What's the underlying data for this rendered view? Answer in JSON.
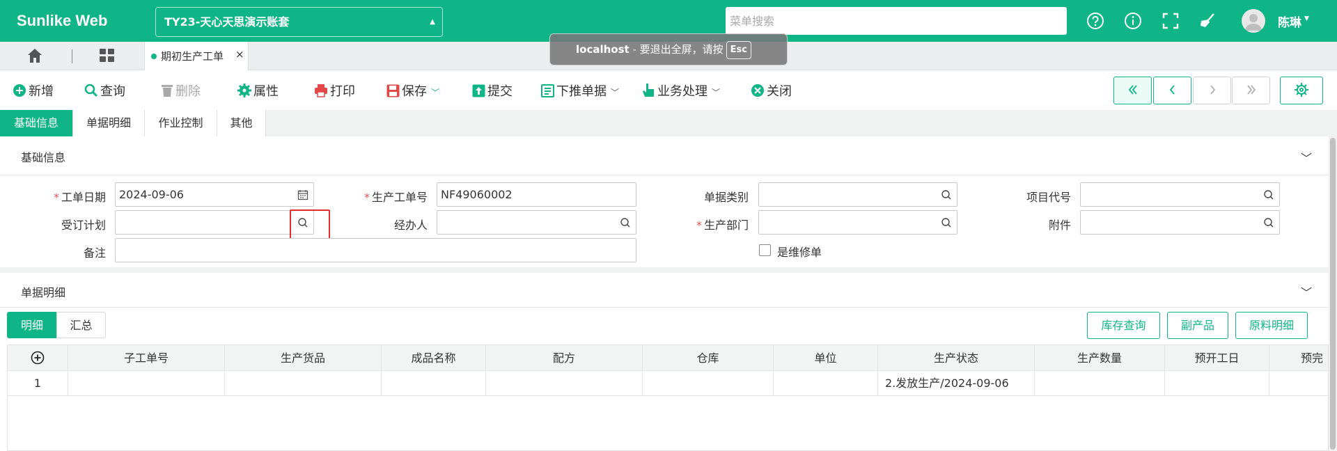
{
  "app": {
    "brand": "Sunlike Web",
    "account": "TY23-天心天思演示账套",
    "menu_search_placeholder": "菜单搜索",
    "user_name": "陈琳",
    "accent_color": "#0fb587",
    "top_icons": [
      "help-icon",
      "info-icon",
      "fullscreen-icon",
      "broom-icon"
    ]
  },
  "tabs": {
    "open_tab": "期初生产工单",
    "close_glyph": "×"
  },
  "toast": {
    "host": "localhost",
    "separator": " - ",
    "message": "要退出全屏，请按",
    "key": "Esc"
  },
  "toolbar": {
    "new": "新增",
    "query": "查询",
    "delete": "删除",
    "properties": "属性",
    "print": "打印",
    "save": "保存",
    "submit": "提交",
    "push_down": "下推单据",
    "business": "业务处理",
    "close": "关闭"
  },
  "section_tabs": [
    "基础信息",
    "单据明细",
    "作业控制",
    "其他"
  ],
  "basic": {
    "title": "基础信息",
    "fields": {
      "work_date_label": "工单日期",
      "work_date_value": "2024-09-06",
      "work_no_label": "生产工单号",
      "work_no_value": "NF49060002",
      "doc_type_label": "单据类别",
      "project_code_label": "项目代号",
      "order_plan_label": "受订计划",
      "handler_label": "经办人",
      "dept_label": "生产部门",
      "attachment_label": "附件",
      "remark_label": "备注",
      "repair_label": "是维修单"
    }
  },
  "detail": {
    "title": "单据明细",
    "subtabs": [
      "明细",
      "汇总"
    ],
    "actions": [
      "库存查询",
      "副产品",
      "原料明细"
    ],
    "columns": [
      "子工单号",
      "生产货品",
      "成品名称",
      "配方",
      "仓库",
      "单位",
      "生产状态",
      "生产数量",
      "预开工日",
      "预完"
    ],
    "rows": [
      {
        "no": "1",
        "status": "2.发放生产/2024-09-06"
      }
    ]
  }
}
